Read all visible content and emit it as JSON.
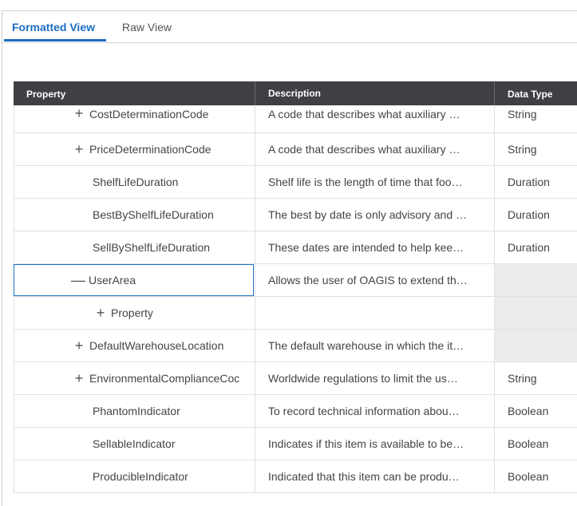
{
  "tabs": {
    "formatted": "Formatted View",
    "raw": "Raw View"
  },
  "columns": {
    "property": "Property",
    "description": "Description",
    "data_type": "Data Type"
  },
  "rows": [
    {
      "expander": "+",
      "property": "CostDeterminationCode",
      "description": "A code that describes what auxiliary …",
      "data_type": "String"
    },
    {
      "expander": "+",
      "property": "PriceDeterminationCode",
      "description": "A code that describes what auxiliary …",
      "data_type": "String"
    },
    {
      "expander": "",
      "property": "ShelfLifeDuration",
      "description": "Shelf life is the length of time that foo…",
      "data_type": "Duration"
    },
    {
      "expander": "",
      "property": "BestByShelfLifeDuration",
      "description": "The best by date is only advisory and …",
      "data_type": "Duration"
    },
    {
      "expander": "",
      "property": "SellByShelfLifeDuration",
      "description": "These dates are intended to help kee…",
      "data_type": "Duration"
    },
    {
      "expander": "—",
      "property": "UserArea",
      "description": "Allows the user of OAGIS to extend th…",
      "data_type": ""
    },
    {
      "expander": "+",
      "property": "Property",
      "description": "",
      "data_type": ""
    },
    {
      "expander": "+",
      "property": "DefaultWarehouseLocation",
      "description": "The default warehouse in which the it…",
      "data_type": ""
    },
    {
      "expander": "+",
      "property": "EnvironmentalComplianceCoc",
      "description": "Worldwide regulations to limit the us…",
      "data_type": "String"
    },
    {
      "expander": "",
      "property": "PhantomIndicator",
      "description": "To record technical information abou…",
      "data_type": "Boolean"
    },
    {
      "expander": "",
      "property": "SellableIndicator",
      "description": "Indicates if this item is available to be…",
      "data_type": "Boolean"
    },
    {
      "expander": "",
      "property": "ProducibleIndicator",
      "description": "Indicated that this item can be produ…",
      "data_type": "Boolean"
    }
  ],
  "colors": {
    "accent": "#1b6ec2",
    "header_bg": "#3f3f44",
    "empty_cell_bg": "#ececec"
  }
}
